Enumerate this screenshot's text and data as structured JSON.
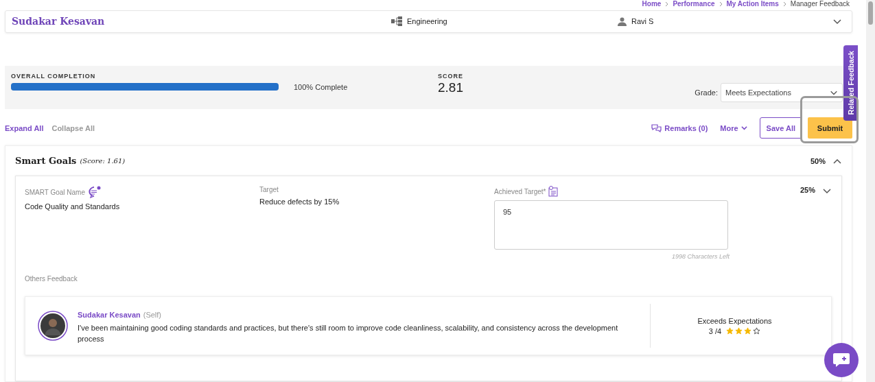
{
  "breadcrumb": [
    "Home",
    "Performance",
    "My Action Items",
    "Manager Feedback"
  ],
  "header": {
    "employee_name": "Sudakar Kesavan",
    "department": "Engineering",
    "manager": "Ravi S",
    "expanded": false
  },
  "completion": {
    "label": "OVERALL COMPLETION",
    "level": 1,
    "text": "100% Complete"
  },
  "score": {
    "label": "SCORE",
    "value": "2.81"
  },
  "grade": {
    "label": "Grade:",
    "value": "Meets Expectations"
  },
  "toolbar": {
    "expand_all": "Expand All",
    "collapse_all": "Collapse All",
    "remarks": "Remarks (0)",
    "more": "More",
    "save_all": "Save All",
    "submit": "Submit"
  },
  "side_tab": "Related Feedback",
  "section": {
    "title": "Smart Goals",
    "score": "(Score: 1.61)",
    "percent": "50%",
    "expanded": true,
    "goal": {
      "name_label": "SMART Goal Name",
      "name": "Code Quality and Standards",
      "target_label": "Target",
      "target": "Reduce defects by 15%",
      "achieved_label": "Achieved Target*",
      "achieved_value": "95",
      "chars_left": "1998 Characters Left",
      "percent": "25%",
      "expanded": false
    },
    "others_label": "Others Feedback",
    "feedback": [
      {
        "name": "Sudakar Kesavan",
        "role": "(Self)",
        "text": "I've been maintaining good coding standards and practices, but there's still room to improve code cleanliness, scalability, and consistency across the development process",
        "grade": "Exceeds Expectations",
        "rating": "3 /4",
        "stars": 3
      }
    ]
  }
}
